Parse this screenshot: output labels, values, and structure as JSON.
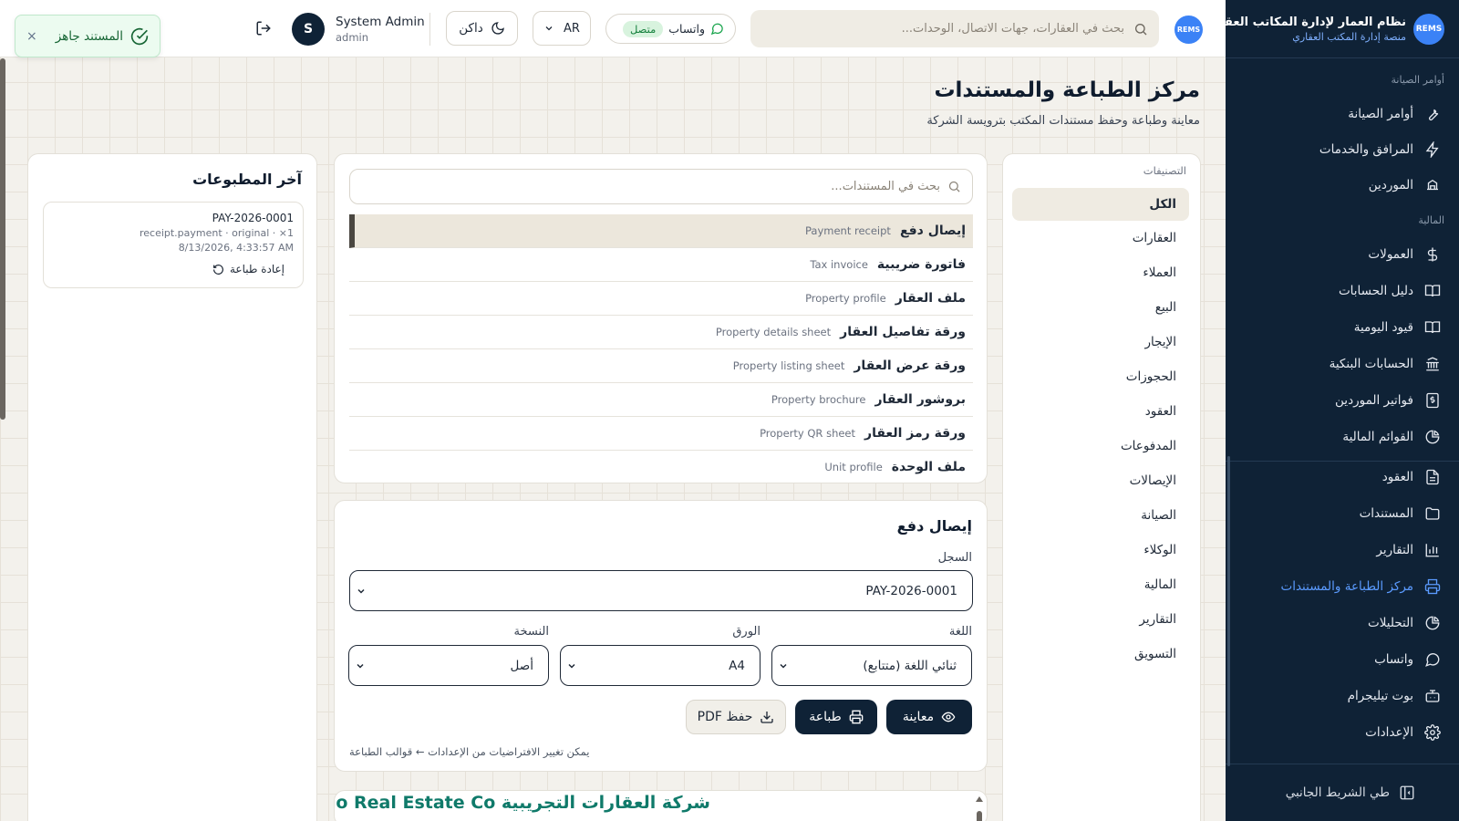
{
  "brand": {
    "logo_text": "REMS",
    "name": "نظام العمار لإدارة المكاتب العقارية",
    "subtitle": "منصة إدارة المكتب العقاري"
  },
  "sidebar": {
    "sections": [
      {
        "label": "أوامر الصيانة"
      },
      {
        "label": "المالية"
      }
    ],
    "items": [
      {
        "label": "أوامر الصيانة",
        "icon": "wrench-icon"
      },
      {
        "label": "المرافق والخدمات",
        "icon": "bolt-icon"
      },
      {
        "label": "الموردين",
        "icon": "truck-icon"
      },
      {
        "label": "العمولات",
        "icon": "dollar-icon"
      },
      {
        "label": "دليل الحسابات",
        "icon": "book-icon"
      },
      {
        "label": "قيود اليومية",
        "icon": "book-open-icon"
      },
      {
        "label": "الحسابات البنكية",
        "icon": "bank-icon"
      },
      {
        "label": "فواتير الموردين",
        "icon": "invoice-icon"
      },
      {
        "label": "القوائم المالية",
        "icon": "pie-chart-icon"
      },
      {
        "label": "العقود",
        "icon": "file-icon"
      },
      {
        "label": "المستندات",
        "icon": "folder-icon"
      },
      {
        "label": "التقارير",
        "icon": "bar-chart-icon"
      },
      {
        "label": "مركز الطباعة والمستندات",
        "icon": "printer-icon",
        "active": true
      },
      {
        "label": "التحليلات",
        "icon": "pie-chart-icon"
      },
      {
        "label": "واتساب",
        "icon": "chat-icon"
      },
      {
        "label": "بوت تيليجرام",
        "icon": "bot-icon"
      },
      {
        "label": "الإعدادات",
        "icon": "gear-icon"
      }
    ],
    "collapse_label": "طي الشريط الجانبي",
    "active_color": "#5b9bff"
  },
  "topbar": {
    "logo_text": "REMS",
    "search_placeholder": "بحث في العقارات، جهات الاتصال، الوحدات...",
    "whatsapp_label": "واتساب",
    "whatsapp_status": "متصل",
    "language": "AR",
    "theme_label": "داكن",
    "user": {
      "initial": "S",
      "name": "System Admin",
      "role": "admin"
    }
  },
  "toast": {
    "message": "المستند جاهز",
    "close": "×"
  },
  "page": {
    "title": "مركز الطباعة والمستندات",
    "subtitle": "معاينة وطباعة وحفظ مستندات المكتب بترويسة الشركة"
  },
  "categories": {
    "label": "التصنيفات",
    "items": [
      "الكل",
      "العقارات",
      "العملاء",
      "البيع",
      "الإيجار",
      "الحجوزات",
      "العقود",
      "المدفوعات",
      "الإيصالات",
      "الصيانة",
      "الوكلاء",
      "المالية",
      "التقارير",
      "التسويق"
    ]
  },
  "documents": {
    "search_placeholder": "بحث في المستندات...",
    "items": [
      {
        "ar": "إيصال دفع",
        "en": "Payment receipt",
        "active": true
      },
      {
        "ar": "فاتورة ضريبية",
        "en": "Tax invoice"
      },
      {
        "ar": "ملف العقار",
        "en": "Property profile"
      },
      {
        "ar": "ورقة تفاصيل العقار",
        "en": "Property details sheet"
      },
      {
        "ar": "ورقة عرض العقار",
        "en": "Property listing sheet"
      },
      {
        "ar": "بروشور العقار",
        "en": "Property brochure"
      },
      {
        "ar": "ورقة رمز العقار",
        "en": "Property QR sheet"
      },
      {
        "ar": "ملف الوحدة",
        "en": "Unit profile"
      }
    ]
  },
  "form": {
    "title": "إيصال دفع",
    "record_label": "السجل",
    "record_value": "PAY-2026-0001",
    "language_label": "اللغة",
    "language_value": "ثنائي اللغة (متتابع)",
    "paper_label": "الورق",
    "paper_value": "A4",
    "copy_label": "النسخة",
    "copy_value": "أصل",
    "preview_button": "معاينة",
    "print_button": "طباعة",
    "pdf_button": "حفظ PDF",
    "hint": "يمكن تغيير الافتراضيات من الإعدادات ← قوالب الطباعة"
  },
  "preview": {
    "company_name": "شركة العقارات التجريبية Demo Real Estate Co."
  },
  "recent": {
    "title": "آخر المطبوعات",
    "items": [
      {
        "code": "PAY-2026-0001",
        "meta": "receipt.payment · original · ×1",
        "date": "8/13/2026, 4:33:57 AM",
        "reprint_label": "إعادة طباعة"
      }
    ]
  }
}
